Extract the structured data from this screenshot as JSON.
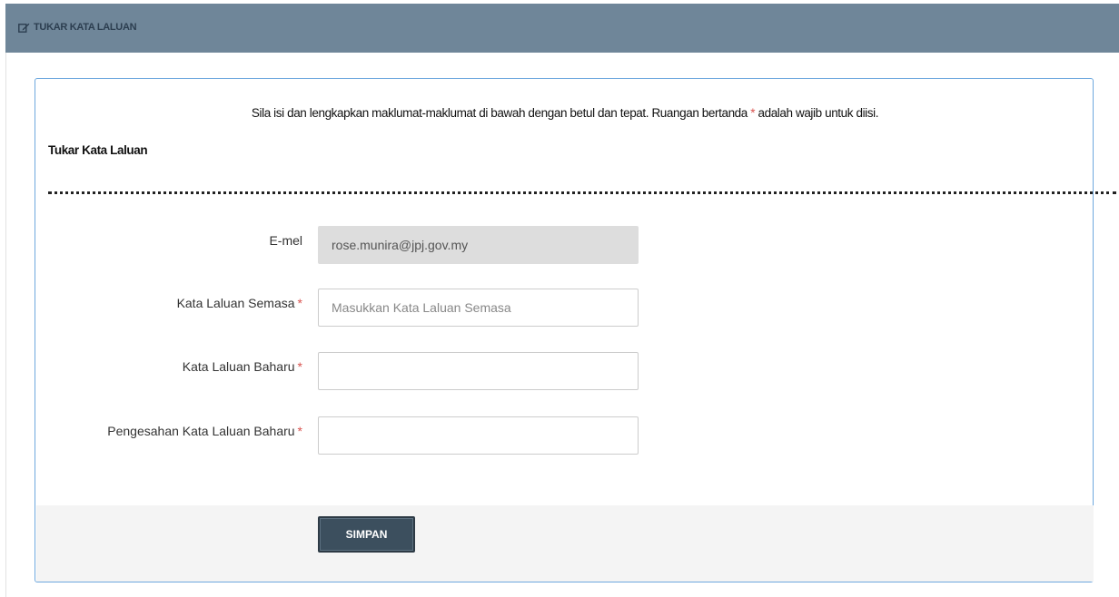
{
  "header": {
    "title": "TUKAR KATA LALUAN",
    "icon": "edit-icon"
  },
  "panel": {
    "instruction_prefix": "Sila isi dan lengkapkan maklumat-maklumat di bawah dengan betul dan tepat. Ruangan bertanda",
    "required_marker": "*",
    "instruction_suffix": "adalah wajib untuk diisi.",
    "section_title": "Tukar Kata Laluan"
  },
  "form": {
    "email": {
      "label": "E-mel",
      "value": "rose.munira@jpj.gov.my"
    },
    "current_password": {
      "label": "Kata Laluan Semasa",
      "required": "*",
      "placeholder": "Masukkan Kata Laluan Semasa",
      "value": ""
    },
    "new_password": {
      "label": "Kata Laluan Baharu",
      "required": "*",
      "placeholder": "",
      "value": ""
    },
    "confirm_password": {
      "label": "Pengesahan Kata Laluan Baharu",
      "required": "*",
      "placeholder": "",
      "value": ""
    },
    "save_label": "SIMPAN"
  },
  "colors": {
    "header_bg": "#6f8699",
    "panel_border": "#6ea8de",
    "required": "#d9534f",
    "button_bg": "#3c4f5e"
  }
}
